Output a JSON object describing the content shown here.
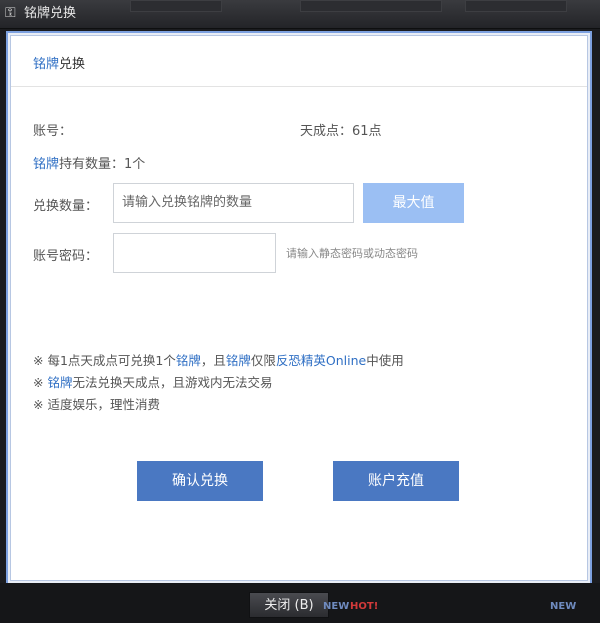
{
  "window": {
    "title": "铭牌兑换",
    "close_label": "关闭 (B)"
  },
  "dialog": {
    "header_highlight": "铭牌",
    "header_rest": "兑换",
    "account_label": "账号：",
    "points_label": "天成点：61点",
    "hold_highlight": "铭牌",
    "hold_rest": "持有数量：1个",
    "exchange_label": "兑换数量：",
    "exchange_placeholder": "请输入兑换铭牌的数量",
    "max_button": "最大值",
    "password_label": "账号密码：",
    "password_hint": "请输入静态密码或动态密码",
    "notes": {
      "n1_a": "※ 每1点天成点可兑换1个",
      "n1_b": "铭牌",
      "n1_c": "，且",
      "n1_d": "铭牌",
      "n1_e": "仅限",
      "n1_f": "反恐精英Online",
      "n1_g": "中使用",
      "n2_a": "※ ",
      "n2_b": "铭牌",
      "n2_c": "无法兑换天成点，且游戏内无法交易",
      "n3": "※ 适度娱乐，理性消费"
    },
    "confirm_button": "确认兑换",
    "recharge_button": "账户充值"
  },
  "bottom": {
    "new_badge": "NEW",
    "hot_badge": "HOT!"
  },
  "colors": {
    "accent_blue": "#2f6fc4",
    "button_dark": "#4a78c2",
    "button_light": "#9bbff3"
  }
}
